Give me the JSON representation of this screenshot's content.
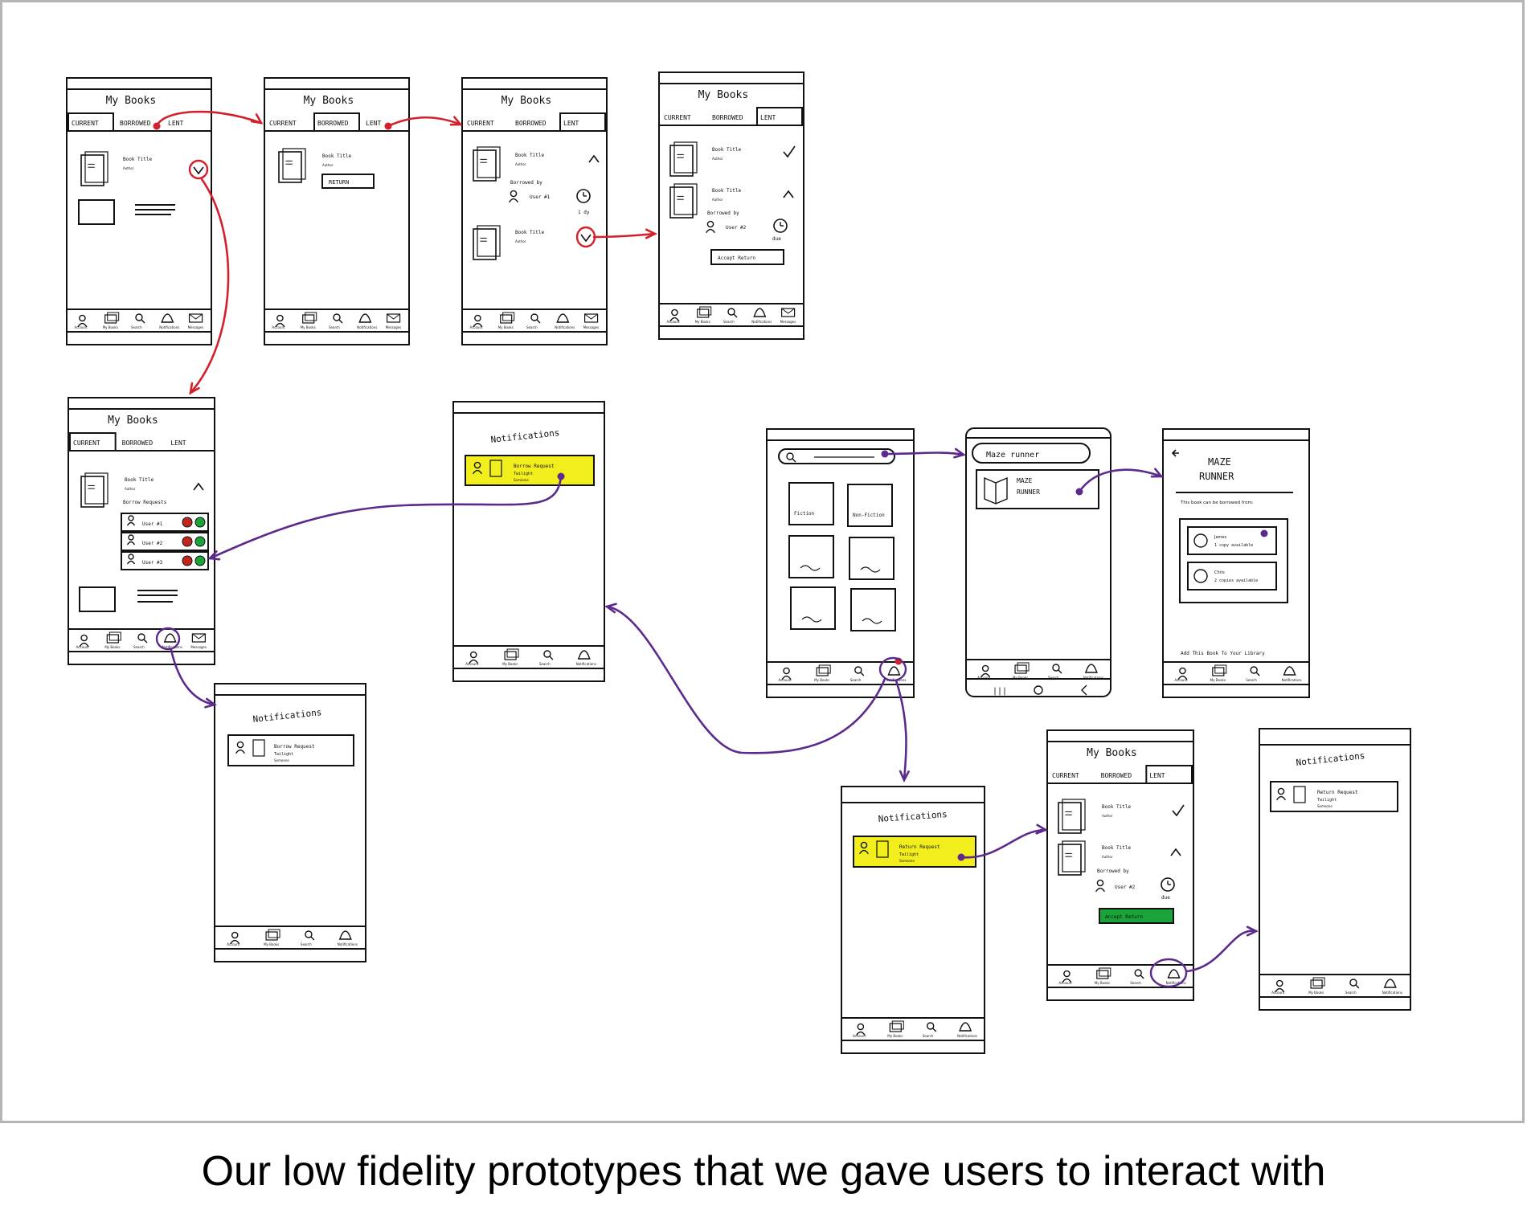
{
  "caption": "Our low fidelity prototypes that we gave users to interact with",
  "colors": {
    "red_arrow": "#d4202a",
    "purple_arrow": "#5b2a8c",
    "highlight_yellow": "#f2ee1d",
    "accept_green": "#1aa33a",
    "reject_red": "#c0261e"
  },
  "my_books": {
    "title": "My Books",
    "tabs": [
      "CURRENT",
      "BORROWED",
      "LENT"
    ],
    "book_title": "Book Title",
    "author": "Author",
    "return_button": "RETURN",
    "borrower": "Borrowed by",
    "user_1": "User #1",
    "user_2": "User #2",
    "user_3": "User #3",
    "due": "due",
    "accept_return": "Accept Return",
    "borrow_requests": "Borrow Requests"
  },
  "notifications": {
    "title": "Notifications",
    "borrow_request": "Borrow Request",
    "return_request": "Return Request",
    "book": "Twilight",
    "author": "Someone"
  },
  "search": {
    "categories": [
      "Fiction",
      "Non-Fiction"
    ],
    "query": "Maze runner",
    "result_title": "MAZE RUNNER"
  },
  "book_detail": {
    "title": "MAZE RUNNER",
    "subtitle": "This book can be borrowed from:",
    "lenders": [
      {
        "name": "James",
        "status": "1 copy available"
      },
      {
        "name": "Chris",
        "status": "2 copies available"
      }
    ],
    "footer": "Add This Book To Your Library"
  },
  "nav_items": [
    {
      "icon": "profile-icon",
      "label": "Account"
    },
    {
      "icon": "books-icon",
      "label": "My Books"
    },
    {
      "icon": "search-icon",
      "label": "Search"
    },
    {
      "icon": "bell-icon",
      "label": "Notifications"
    },
    {
      "icon": "mail-icon",
      "label": "Messages"
    }
  ]
}
